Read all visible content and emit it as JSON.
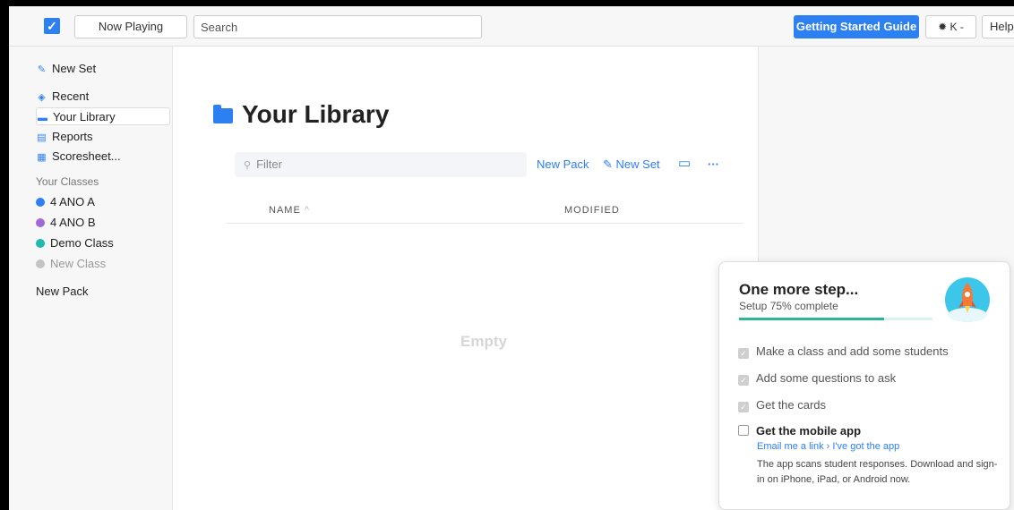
{
  "topbar": {
    "now_playing_label": "Now Playing",
    "search_placeholder": "Search",
    "guide_label": "Getting Started Guide",
    "account_label": "K -",
    "help_label": "Help"
  },
  "sidebar": {
    "items": [
      {
        "label": "New Set",
        "icon": "edit-icon"
      },
      {
        "label": "Recent",
        "icon": "recent-icon"
      },
      {
        "label": "Your Library",
        "icon": "folder-icon"
      },
      {
        "label": "Reports",
        "icon": "reports-icon"
      },
      {
        "label": "Scoresheet...",
        "icon": "grid-icon"
      }
    ],
    "classes_heading": "Your Classes",
    "classes": [
      {
        "label": "4 ANO A",
        "color": "#2d80f2"
      },
      {
        "label": "4 ANO B",
        "color": "#a069d4"
      },
      {
        "label": "Demo Class",
        "color": "#20b9b0"
      }
    ],
    "new_class_label": "New Class",
    "new_pack_label": "New Pack"
  },
  "main": {
    "title": "Your Library",
    "filter_placeholder": "Filter",
    "new_pack_link": "New Pack",
    "new_set_link": "New Set",
    "more_label": "···",
    "col_name": "NAME",
    "col_modified": "MODIFIED",
    "empty_label": "Empty"
  },
  "card": {
    "title": "One more step...",
    "subtitle": "Setup 75% complete",
    "progress_fraction": 0.75,
    "tasks": [
      {
        "label": "Make a class and add some students",
        "done": true
      },
      {
        "label": "Add some questions to ask",
        "done": true
      },
      {
        "label": "Get the cards",
        "done": true
      },
      {
        "label": "Get the mobile app",
        "done": false
      }
    ],
    "email_link": "Email me a link",
    "got_app_link": "I've got the app",
    "app_desc": "The app scans student responses. Download and sign-in on iPhone, iPad, or Android now."
  },
  "colors": {
    "accent": "#2d80f2",
    "progress": "#2bb59b"
  }
}
